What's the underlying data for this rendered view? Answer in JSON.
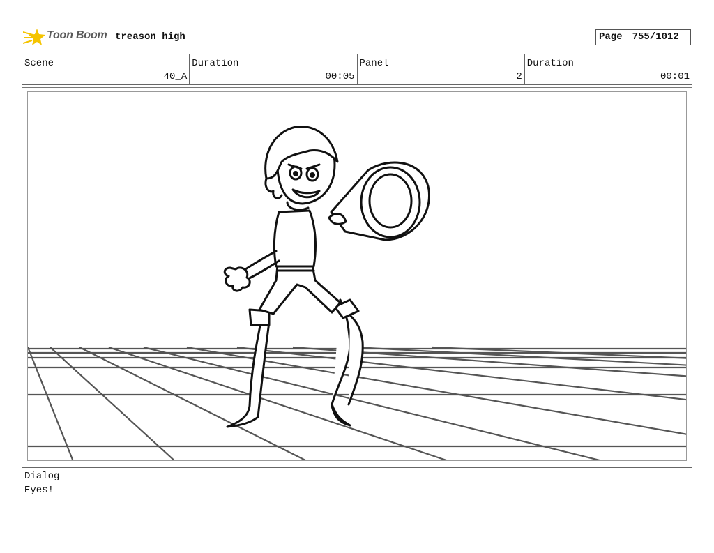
{
  "header": {
    "logo_text": "Toon Boom",
    "project_title": "treason high",
    "page_label": "Page",
    "page_number": "755/1012"
  },
  "info": {
    "scene_label": "Scene",
    "scene_value": "40_A",
    "scene_duration_label": "Duration",
    "scene_duration_value": "00:05",
    "panel_label": "Panel",
    "panel_value": "2",
    "panel_duration_label": "Duration",
    "panel_duration_value": "00:01"
  },
  "dialog": {
    "label": "Dialog",
    "text": "Eyes!"
  },
  "colors": {
    "logo_accent": "#f5c400",
    "grid_line": "#555555",
    "ink": "#111111"
  },
  "icons": {
    "logo": "toon-boom-star-icon"
  }
}
